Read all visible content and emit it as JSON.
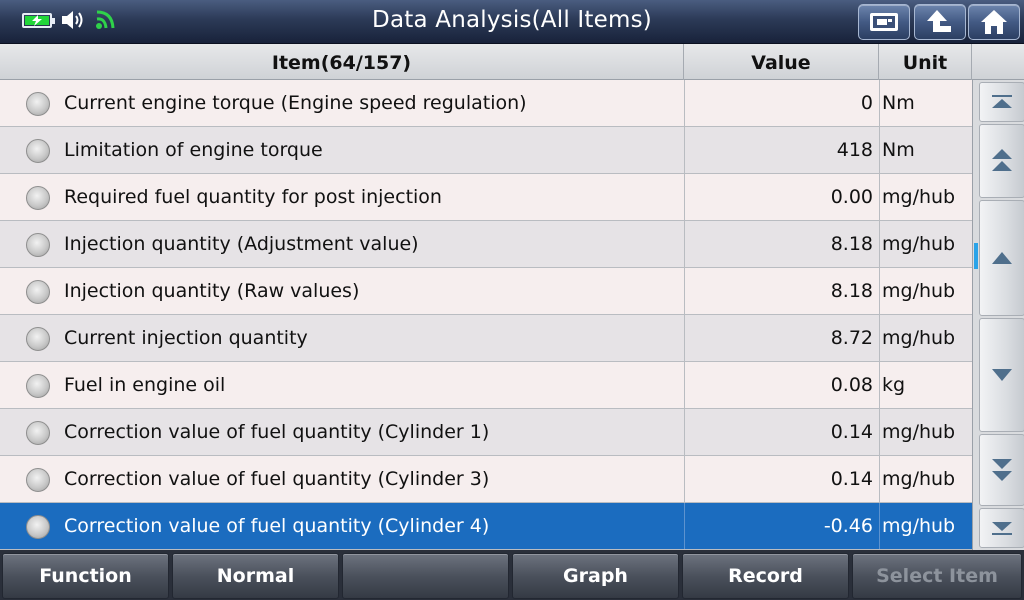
{
  "header": {
    "title": "Data Analysis(All Items)"
  },
  "table": {
    "columns": {
      "item": "Item(64/157)",
      "value": "Value",
      "unit": "Unit"
    },
    "rows": [
      {
        "name": "Current engine torque (Engine speed regulation)",
        "value": "0",
        "unit": "Nm"
      },
      {
        "name": "Limitation of engine torque",
        "value": "418",
        "unit": "Nm"
      },
      {
        "name": "Required fuel quantity for post injection",
        "value": "0.00",
        "unit": "mg/hub"
      },
      {
        "name": "Injection quantity (Adjustment value)",
        "value": "8.18",
        "unit": "mg/hub"
      },
      {
        "name": "Injection quantity (Raw values)",
        "value": "8.18",
        "unit": "mg/hub"
      },
      {
        "name": "Current injection quantity",
        "value": "8.72",
        "unit": "mg/hub"
      },
      {
        "name": "Fuel in engine oil",
        "value": "0.08",
        "unit": "kg"
      },
      {
        "name": "Correction value of fuel quantity (Cylinder 1)",
        "value": "0.14",
        "unit": "mg/hub"
      },
      {
        "name": "Correction value of fuel quantity (Cylinder 3)",
        "value": "0.14",
        "unit": "mg/hub"
      },
      {
        "name": "Correction value of fuel quantity (Cylinder 4)",
        "value": "-0.46",
        "unit": "mg/hub"
      }
    ],
    "selected_row": 9
  },
  "bottom": {
    "function": "Function",
    "normal": "Normal",
    "empty": "",
    "graph": "Graph",
    "record": "Record",
    "select_item": "Select Item"
  },
  "icons": {
    "battery": "battery-charging-icon",
    "speaker": "speaker-icon",
    "wifi": "wifi-icon",
    "screenshot": "screenshot-icon",
    "back": "back-arrow-icon",
    "home": "home-icon",
    "scroll_top": "scroll-top-icon",
    "page_up": "page-up-icon",
    "line_up": "line-up-icon",
    "line_down": "line-down-icon",
    "page_down": "page-down-icon",
    "scroll_bottom": "scroll-bottom-icon"
  },
  "colors": {
    "selected_row": "#1b6cbf",
    "battery": "#22d63a",
    "wifi": "#2fd24a",
    "scroll_indicator": "#2aa3e8"
  }
}
